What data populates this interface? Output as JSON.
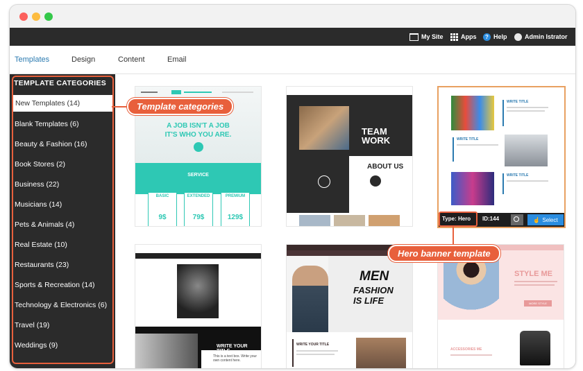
{
  "topbar": {
    "mysite": "My Site",
    "apps": "Apps",
    "help": "Help",
    "user": "Admin Istrator"
  },
  "tabs": [
    "Templates",
    "Design",
    "Content",
    "Email"
  ],
  "sidebar": {
    "title": "TEMPLATE CATEGORIES",
    "items": [
      {
        "label": "New Templates (14)",
        "active": true
      },
      {
        "label": "Blank Templates (6)"
      },
      {
        "label": "Beauty & Fashion (16)"
      },
      {
        "label": "Book Stores (2)"
      },
      {
        "label": "Business (22)"
      },
      {
        "label": "Musicians (14)"
      },
      {
        "label": "Pets & Animals (4)"
      },
      {
        "label": "Real Estate (10)"
      },
      {
        "label": "Restaurants (23)"
      },
      {
        "label": "Sports & Recreation (14)"
      },
      {
        "label": "Technology & Electronics (6)"
      },
      {
        "label": "Travel (19)"
      },
      {
        "label": "Weddings (9)"
      }
    ]
  },
  "callouts": {
    "categories": "Template categories",
    "hero": "Hero banner template"
  },
  "cards": {
    "t1": {
      "headline1": "A JOB ISN'T A JOB",
      "headline2": "IT'S WHO YOU ARE.",
      "service": "SERVICE",
      "plans": [
        "BASIC",
        "EXTENDED",
        "PREMIUM"
      ],
      "prices": [
        "9$",
        "79$",
        "129$"
      ]
    },
    "t2": {
      "team1": "TEAM",
      "team2": "WORK",
      "about": "ABOUT US"
    },
    "t3": {
      "type": "Type: Hero",
      "id": "ID:144",
      "select": "Select",
      "write": "WRITE TITLE"
    },
    "t4": {
      "write": "WRITE YOUR TITLE",
      "body": "This is a text box. Write your own content here."
    },
    "t5": {
      "men": "MEN",
      "fashion": "FASHION",
      "islife": "IS LIFE",
      "write": "WRITE YOUR TITLE"
    },
    "t6": {
      "style": "STYLE ME",
      "accessories": "ACCESSORIES ME",
      "btn": "MORE STYLE"
    }
  },
  "colors": {
    "accent": "#e8603c",
    "teal": "#2ec8b4",
    "link": "#2a7ab0",
    "select": "#2b8de0"
  }
}
